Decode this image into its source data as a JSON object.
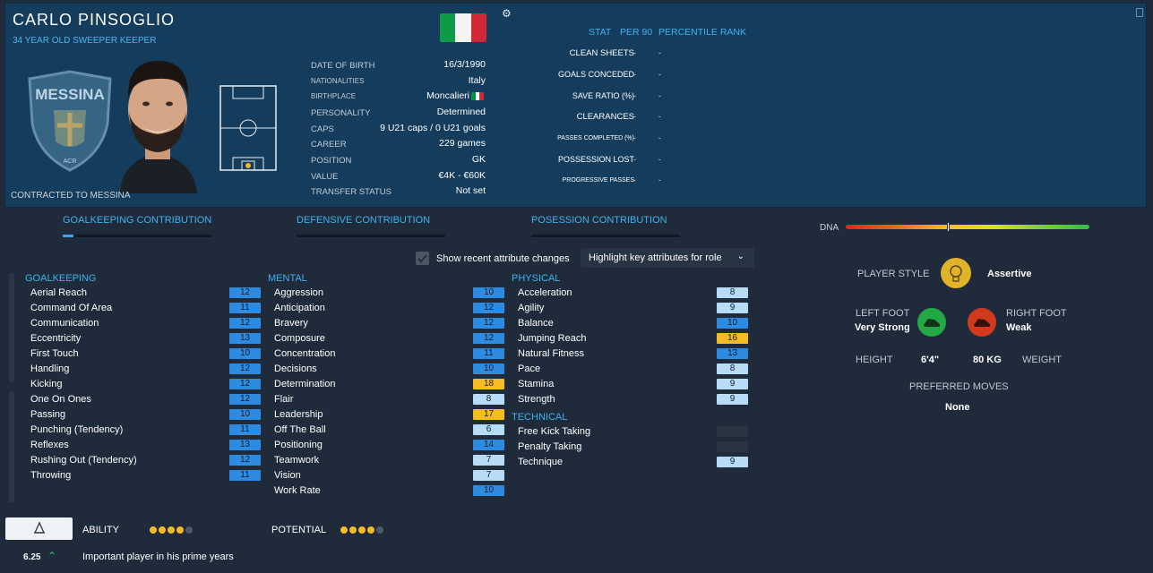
{
  "player": {
    "name": "CARLO PINSOGLIO",
    "subtitle": "34 YEAR OLD  SWEEPER KEEPER",
    "contracted": "CONTRACTED TO MESSINA",
    "club_badge_text": "MESSINA",
    "club_badge_subtext": "ACR"
  },
  "info": [
    {
      "label": "DATE OF BIRTH",
      "value": "16/3/1990"
    },
    {
      "label": "NATIONALITIES",
      "value": "Italy"
    },
    {
      "label": "BIRTHPLACE",
      "value": "Moncalieri"
    },
    {
      "label": "PERSONALITY",
      "value": "Determined"
    },
    {
      "label": "CAPS",
      "value": "9 U21 caps / 0 U21 goals"
    },
    {
      "label": "CAREER",
      "value": "229  games"
    },
    {
      "label": "POSITION",
      "value": "GK"
    },
    {
      "label": "VALUE",
      "value": "€4K - €60K"
    },
    {
      "label": "TRANSFER STATUS",
      "value": "Not set"
    }
  ],
  "stats": {
    "headers": {
      "stat": "STAT",
      "per90": "PER 90",
      "percentile": "PERCENTILE RANK"
    },
    "rows": [
      {
        "label": "CLEAN SHEETS",
        "per90": "-",
        "rank": "-"
      },
      {
        "label": "GOALS CONCEDED",
        "per90": "-",
        "rank": "-"
      },
      {
        "label": "SAVE RATIO (%)",
        "per90": "-",
        "rank": "-"
      },
      {
        "label": "CLEARANCES",
        "per90": "-",
        "rank": "-"
      },
      {
        "label": "PASSES COMPLETED (%)",
        "per90": "-",
        "rank": "-"
      },
      {
        "label": "POSSESSION LOST",
        "per90": "-",
        "rank": "-"
      },
      {
        "label": "PROGRESSIVE PASSES",
        "per90": "-",
        "rank": "-"
      }
    ]
  },
  "tabs": [
    {
      "label": "GOALKEEPING CONTRIBUTION"
    },
    {
      "label": "DEFENSIVE CONTRIBUTION"
    },
    {
      "label": "POSESSION CONTRIBUTION"
    }
  ],
  "dna_label": "DNA",
  "controls": {
    "show_changes": "Show recent attribute changes",
    "highlight": "Highlight key attributes for role"
  },
  "attributes": {
    "goalkeeping": {
      "title": "GOALKEEPING",
      "items": [
        {
          "name": "Aerial Reach",
          "value": "12",
          "tier": "blue"
        },
        {
          "name": "Command Of Area",
          "value": "11",
          "tier": "blue"
        },
        {
          "name": "Communication",
          "value": "12",
          "tier": "blue"
        },
        {
          "name": "Eccentricity",
          "value": "13",
          "tier": "blue"
        },
        {
          "name": "First Touch",
          "value": "10",
          "tier": "blue"
        },
        {
          "name": "Handling",
          "value": "12",
          "tier": "blue"
        },
        {
          "name": "Kicking",
          "value": "12",
          "tier": "blue"
        },
        {
          "name": "One On Ones",
          "value": "12",
          "tier": "blue"
        },
        {
          "name": "Passing",
          "value": "10",
          "tier": "blue"
        },
        {
          "name": "Punching (Tendency)",
          "value": "11",
          "tier": "blue"
        },
        {
          "name": "Reflexes",
          "value": "13",
          "tier": "blue"
        },
        {
          "name": "Rushing Out (Tendency)",
          "value": "12",
          "tier": "blue"
        },
        {
          "name": "Throwing",
          "value": "11",
          "tier": "blue"
        }
      ]
    },
    "mental": {
      "title": "MENTAL",
      "items": [
        {
          "name": "Aggression",
          "value": "10",
          "tier": "blue"
        },
        {
          "name": "Anticipation",
          "value": "12",
          "tier": "blue"
        },
        {
          "name": "Bravery",
          "value": "12",
          "tier": "blue"
        },
        {
          "name": "Composure",
          "value": "12",
          "tier": "blue"
        },
        {
          "name": "Concentration",
          "value": "11",
          "tier": "blue"
        },
        {
          "name": "Decisions",
          "value": "10",
          "tier": "blue"
        },
        {
          "name": "Determination",
          "value": "18",
          "tier": "gold"
        },
        {
          "name": "Flair",
          "value": "8",
          "tier": "light"
        },
        {
          "name": "Leadership",
          "value": "17",
          "tier": "gold"
        },
        {
          "name": "Off The Ball",
          "value": "6",
          "tier": "light"
        },
        {
          "name": "Positioning",
          "value": "14",
          "tier": "blue"
        },
        {
          "name": "Teamwork",
          "value": "7",
          "tier": "light"
        },
        {
          "name": "Vision",
          "value": "7",
          "tier": "light"
        },
        {
          "name": "Work Rate",
          "value": "10",
          "tier": "blue"
        }
      ]
    },
    "physical": {
      "title": "PHYSICAL",
      "items": [
        {
          "name": "Acceleration",
          "value": "8",
          "tier": "light"
        },
        {
          "name": "Agility",
          "value": "9",
          "tier": "light"
        },
        {
          "name": "Balance",
          "value": "10",
          "tier": "blue"
        },
        {
          "name": "Jumping Reach",
          "value": "16",
          "tier": "gold"
        },
        {
          "name": "Natural Fitness",
          "value": "13",
          "tier": "blue"
        },
        {
          "name": "Pace",
          "value": "8",
          "tier": "light"
        },
        {
          "name": "Stamina",
          "value": "9",
          "tier": "light"
        },
        {
          "name": "Strength",
          "value": "9",
          "tier": "light"
        }
      ]
    },
    "technical": {
      "title": "TECHNICAL",
      "items": [
        {
          "name": "Free Kick Taking",
          "value": "",
          "tier": "empty"
        },
        {
          "name": "Penalty Taking",
          "value": "",
          "tier": "empty"
        },
        {
          "name": "Technique",
          "value": "9",
          "tier": "light"
        }
      ]
    }
  },
  "profile": {
    "player_style_label": "PLAYER STYLE",
    "player_style_value": "Assertive",
    "left_foot_label": "LEFT FOOT",
    "left_foot_value": "Very Strong",
    "right_foot_label": "RIGHT FOOT",
    "right_foot_value": "Weak",
    "height_label": "HEIGHT",
    "height_value": "6'4\"",
    "weight_value": "80 KG",
    "weight_label": "WEIGHT",
    "preferred_moves_label": "PREFERRED MOVES",
    "preferred_moves_value": "None"
  },
  "footer": {
    "ability_label": "ABILITY",
    "ability_stars": 4,
    "potential_label": "POTENTIAL",
    "potential_stars": 4,
    "rating": "6.25",
    "note": "Important player in his prime years"
  },
  "colors": {
    "header_bg": "#143c5c",
    "page_bg": "#1f2b3a",
    "accent": "#3fb2ee",
    "badge_blue": "#2d8be2",
    "badge_light": "#b8dcf8",
    "badge_gold": "#f5bc26",
    "left_foot": "#22a845",
    "right_foot": "#d0391c",
    "style_icon": "#e0b32b"
  },
  "icons": {
    "settings": "gear-icon",
    "flag": "italy-flag-icon",
    "player_style": "lightbulb-icon",
    "foot": "boot-icon",
    "ability": "sail-icon",
    "trend": "chevron-up-icon",
    "dropdown": "chevron-down-icon"
  }
}
